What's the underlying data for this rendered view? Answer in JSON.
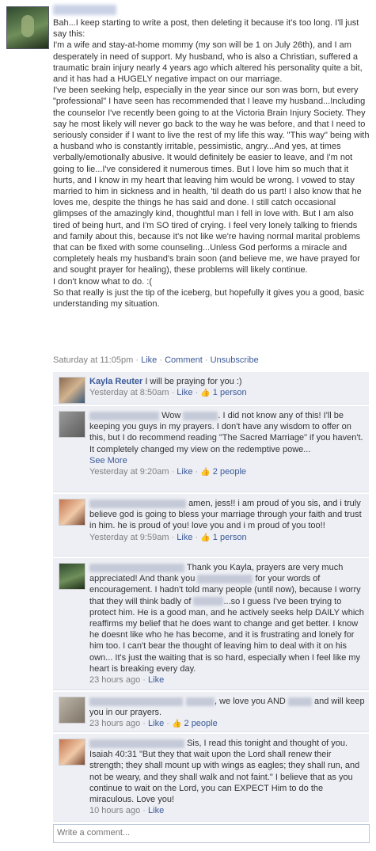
{
  "post": {
    "body_lines": [
      "Bah...I keep starting to write a post, then deleting it because it's too long. I'll just say this:",
      "I'm a wife and stay-at-home mommy (my son will be 1 on July 26th), and I am desperately in need of support. My husband, who is also a Christian, suffered a traumatic brain injury nearly 4 years ago which altered his personality quite a bit, and it has had a HUGELY negative impact on our marriage.",
      "I've been seeking help, especially in the year since our son was born, but every \"professional\" I have seen has recommended that I leave my husband...Including the counselor I've recently been going to at the Victoria Brain Injury Society. They say he most likely will never go back to the way he was before, and that I need to seriously consider if I want to live the rest of my life this way. \"This way\" being with a husband who is constantly irritable, pessimistic, angry...And yes, at times verbally/emotionally abusive. It would definitely be easier to leave, and I'm not going to lie...I've considered it numerous times. But I love him so much that it hurts, and I know in my heart that leaving him would be wrong. I vowed to stay married to him in sickness and in health, 'til death do us part! I also know that he loves me, despite the things he has said and done. I still catch occasional glimpses of the amazingly kind, thoughtful man I fell in love with. But I am also tired of being hurt, and I'm SO tired of crying. I feel very lonely talking to friends and family about this, because it's not like we're having normal marital problems that can be fixed with some counseling...Unless God performs a miracle and completely heals my husband's brain soon (and believe me, we have prayed for and sought prayer for healing), these problems will likely continue.",
      "I don't know what to do. :(",
      "So that really is just the tip of the iceberg, but hopefully it gives you a good, basic understanding my situation."
    ],
    "time": "Saturday at 11:05pm",
    "like": "Like",
    "comment": "Comment",
    "unsubscribe": "Unsubscribe"
  },
  "comments": [
    {
      "name": "Kayla Reuter",
      "text": " I will be praying for you :)",
      "time": "Yesterday at 8:50am",
      "like": "Like",
      "likes": "1 person"
    },
    {
      "text_a": "Wow ",
      "text_b": ". I did not know any of this! I'll be keeping you guys in my prayers. I don't have any wisdom to offer on this, but I do recommend reading \"The Sacred Marriage\" if you haven't. It completely changed my view on the redemptive powe...",
      "see_more": "See More",
      "time": "Yesterday at 9:20am",
      "like": "Like",
      "likes": "2 people"
    },
    {
      "text": "amen, jess!! i am proud of you sis, and i truly believe god is going to bless your marriage through your faith and trust in him. he is proud of you! love you and i m proud of you too!!",
      "time": "Yesterday at 9:59am",
      "like": "Like",
      "likes": "1 person"
    },
    {
      "text_a": "Thank you Kayla, prayers are very much appreciated! And thank you ",
      "text_b": " for your words of encouragement. I hadn't told many people (until now), because I worry that they will think badly of ",
      "text_c": "...so I guess I've been trying to protect him. He is a good man, and he actively seeks help DAILY which reaffirms my belief that he does want to change and get better. I know he doesnt like who he has become, and it is frustrating and lonely for him too. I can't bear the thought of leaving him to deal with it on his own... It's just the waiting that is so hard, especially when I feel like my heart is breaking every day.",
      "time": "23 hours ago",
      "like": "Like"
    },
    {
      "text_a": ", we love you AND ",
      "text_b": " and will keep you in our prayers.",
      "time": "23 hours ago",
      "like": "Like",
      "likes": "2 people"
    },
    {
      "text": "Sis, I read this tonight and thought of you. Isaiah 40:31 \"But they that wait upon the Lord shall renew their strength; they shall mount up with wings as eagles; they shall run, and not be weary, and they shall walk and not faint.\" I believe that as you continue to wait on the Lord, you can EXPECT Him to do the miraculous. Love you!",
      "time": "10 hours ago",
      "like": "Like"
    }
  ],
  "comment_input": {
    "placeholder": "Write a comment..."
  },
  "colors": {
    "link": "#3b5998",
    "comment_bg": "#edeff4",
    "meta": "#808080"
  }
}
